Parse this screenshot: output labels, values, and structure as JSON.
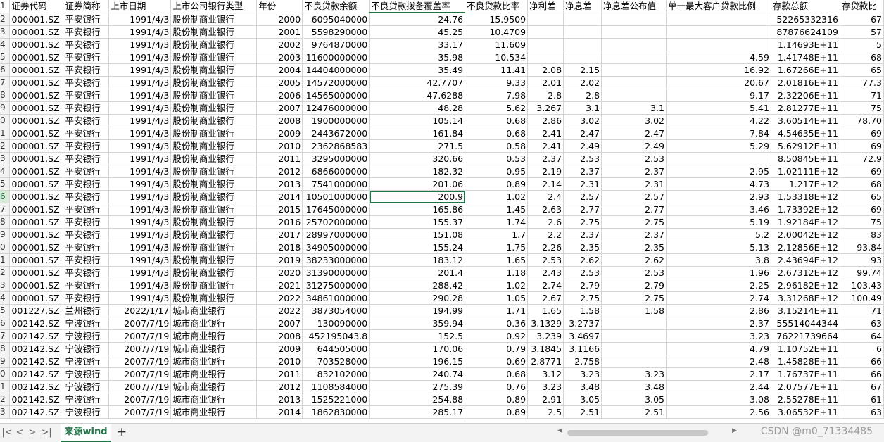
{
  "columns": [
    "证券代码",
    "证券简称",
    "上市日期",
    "上市公司银行类型",
    "年份",
    "不良贷款余额",
    "不良贷款拨备覆盖率",
    "不良贷款比率",
    "净利差",
    "净息差",
    "净息差公布值",
    "单一最大客户贷款比例",
    "存款总额",
    "存贷款比"
  ],
  "row_numbers": [
    "1",
    "2",
    "3",
    "4",
    "5",
    "6",
    "7",
    "8",
    "9",
    "0",
    "1",
    "2",
    "3",
    "4",
    "5",
    "6",
    "7",
    "8",
    "9",
    "0",
    "1",
    "2",
    "3",
    "4",
    "5",
    "6",
    "7",
    "8",
    "9",
    "0",
    "1",
    "2",
    "3"
  ],
  "rows": [
    [
      "000001.SZ",
      "平安银行",
      "1991/4/3",
      "股份制商业银行",
      "2000",
      "6095040000",
      "24.76",
      "15.9509",
      "",
      "",
      "",
      "",
      "52265332316",
      "67"
    ],
    [
      "000001.SZ",
      "平安银行",
      "1991/4/3",
      "股份制商业银行",
      "2001",
      "5598290000",
      "45.25",
      "10.4709",
      "",
      "",
      "",
      "",
      "87876624109",
      "57"
    ],
    [
      "000001.SZ",
      "平安银行",
      "1991/4/3",
      "股份制商业银行",
      "2002",
      "9764870000",
      "33.17",
      "11.609",
      "",
      "",
      "",
      "",
      "1.14693E+11",
      "5"
    ],
    [
      "000001.SZ",
      "平安银行",
      "1991/4/3",
      "股份制商业银行",
      "2003",
      "11600000000",
      "35.98",
      "10.534",
      "",
      "",
      "",
      "4.59",
      "1.41748E+11",
      "68"
    ],
    [
      "000001.SZ",
      "平安银行",
      "1991/4/3",
      "股份制商业银行",
      "2004",
      "14404000000",
      "35.49",
      "11.41",
      "2.08",
      "2.15",
      "",
      "16.92",
      "1.67266E+11",
      "65"
    ],
    [
      "000001.SZ",
      "平安银行",
      "1991/4/3",
      "股份制商业银行",
      "2005",
      "14572000000",
      "42.7707",
      "9.33",
      "2.01",
      "2.02",
      "",
      "20.67",
      "2.01816E+11",
      "77.3"
    ],
    [
      "000001.SZ",
      "平安银行",
      "1991/4/3",
      "股份制商业银行",
      "2006",
      "14565000000",
      "47.6288",
      "7.98",
      "2.8",
      "2.8",
      "",
      "9.17",
      "2.32206E+11",
      "71"
    ],
    [
      "000001.SZ",
      "平安银行",
      "1991/4/3",
      "股份制商业银行",
      "2007",
      "12476000000",
      "48.28",
      "5.62",
      "3.267",
      "3.1",
      "3.1",
      "5.41",
      "2.81277E+11",
      "75"
    ],
    [
      "000001.SZ",
      "平安银行",
      "1991/4/3",
      "股份制商业银行",
      "2008",
      "1900000000",
      "105.14",
      "0.68",
      "2.86",
      "3.02",
      "3.02",
      "4.22",
      "3.60514E+11",
      "78.70"
    ],
    [
      "000001.SZ",
      "平安银行",
      "1991/4/3",
      "股份制商业银行",
      "2009",
      "2443672000",
      "161.84",
      "0.68",
      "2.41",
      "2.47",
      "2.47",
      "7.84",
      "4.54635E+11",
      "69"
    ],
    [
      "000001.SZ",
      "平安银行",
      "1991/4/3",
      "股份制商业银行",
      "2010",
      "2362868583",
      "271.5",
      "0.58",
      "2.41",
      "2.49",
      "2.49",
      "5.29",
      "5.62912E+11",
      "69"
    ],
    [
      "000001.SZ",
      "平安银行",
      "1991/4/3",
      "股份制商业银行",
      "2011",
      "3295000000",
      "320.66",
      "0.53",
      "2.37",
      "2.53",
      "2.53",
      "",
      "8.50845E+11",
      "72.9"
    ],
    [
      "000001.SZ",
      "平安银行",
      "1991/4/3",
      "股份制商业银行",
      "2012",
      "6866000000",
      "182.32",
      "0.95",
      "2.19",
      "2.37",
      "2.37",
      "2.95",
      "1.02111E+12",
      "69"
    ],
    [
      "000001.SZ",
      "平安银行",
      "1991/4/3",
      "股份制商业银行",
      "2013",
      "7541000000",
      "201.06",
      "0.89",
      "2.14",
      "2.31",
      "2.31",
      "4.73",
      "1.217E+12",
      "68"
    ],
    [
      "000001.SZ",
      "平安银行",
      "1991/4/3",
      "股份制商业银行",
      "2014",
      "10501000000",
      "200.9",
      "1.02",
      "2.4",
      "2.57",
      "2.57",
      "2.93",
      "1.53318E+12",
      "65"
    ],
    [
      "000001.SZ",
      "平安银行",
      "1991/4/3",
      "股份制商业银行",
      "2015",
      "17645000000",
      "165.86",
      "1.45",
      "2.63",
      "2.77",
      "2.77",
      "3.46",
      "1.73392E+12",
      "69"
    ],
    [
      "000001.SZ",
      "平安银行",
      "1991/4/3",
      "股份制商业银行",
      "2016",
      "25702000000",
      "155.37",
      "1.74",
      "2.6",
      "2.75",
      "2.75",
      "5.19",
      "1.92184E+12",
      "75"
    ],
    [
      "000001.SZ",
      "平安银行",
      "1991/4/3",
      "股份制商业银行",
      "2017",
      "28997000000",
      "151.08",
      "1.7",
      "2.2",
      "2.37",
      "2.37",
      "5.2",
      "2.00042E+12",
      "83"
    ],
    [
      "000001.SZ",
      "平安银行",
      "1991/4/3",
      "股份制商业银行",
      "2018",
      "34905000000",
      "155.24",
      "1.75",
      "2.26",
      "2.35",
      "2.35",
      "5.13",
      "2.12856E+12",
      "93.84"
    ],
    [
      "000001.SZ",
      "平安银行",
      "1991/4/3",
      "股份制商业银行",
      "2019",
      "38233000000",
      "183.12",
      "1.65",
      "2.53",
      "2.62",
      "2.62",
      "3.8",
      "2.43694E+12",
      "93"
    ],
    [
      "000001.SZ",
      "平安银行",
      "1991/4/3",
      "股份制商业银行",
      "2020",
      "31390000000",
      "201.4",
      "1.18",
      "2.43",
      "2.53",
      "2.53",
      "1.96",
      "2.67312E+12",
      "99.74"
    ],
    [
      "000001.SZ",
      "平安银行",
      "1991/4/3",
      "股份制商业银行",
      "2021",
      "31275000000",
      "288.42",
      "1.02",
      "2.74",
      "2.79",
      "2.79",
      "2.25",
      "2.96182E+12",
      "103.43"
    ],
    [
      "000001.SZ",
      "平安银行",
      "1991/4/3",
      "股份制商业银行",
      "2022",
      "34861000000",
      "290.28",
      "1.05",
      "2.67",
      "2.75",
      "2.75",
      "2.74",
      "3.31268E+12",
      "100.49"
    ],
    [
      "001227.SZ",
      "兰州银行",
      "2022/1/17",
      "城市商业银行",
      "2022",
      "3873054000",
      "194.99",
      "1.71",
      "1.65",
      "1.58",
      "1.58",
      "2.86",
      "3.15214E+11",
      "71"
    ],
    [
      "002142.SZ",
      "宁波银行",
      "2007/7/19",
      "城市商业银行",
      "2007",
      "130090000",
      "359.94",
      "0.36",
      "3.1329",
      "3.2737",
      "",
      "2.37",
      "55514044344",
      "63"
    ],
    [
      "002142.SZ",
      "宁波银行",
      "2007/7/19",
      "城市商业银行",
      "2008",
      "452195043.8",
      "152.5",
      "0.92",
      "3.239",
      "3.4697",
      "",
      "3.23",
      "76221739664",
      "64"
    ],
    [
      "002142.SZ",
      "宁波银行",
      "2007/7/19",
      "城市商业银行",
      "2009",
      "644505000",
      "170.06",
      "0.79",
      "3.1845",
      "3.1166",
      "",
      "4.79",
      "1.10752E+11",
      "6"
    ],
    [
      "002142.SZ",
      "宁波银行",
      "2007/7/19",
      "城市商业银行",
      "2010",
      "703528000",
      "196.15",
      "0.69",
      "2.8771",
      "2.758",
      "",
      "2.48",
      "1.45828E+11",
      "66"
    ],
    [
      "002142.SZ",
      "宁波银行",
      "2007/7/19",
      "城市商业银行",
      "2011",
      "832102000",
      "240.74",
      "0.68",
      "3.12",
      "3.23",
      "3.23",
      "2.17",
      "1.76737E+11",
      "66"
    ],
    [
      "002142.SZ",
      "宁波银行",
      "2007/7/19",
      "城市商业银行",
      "2012",
      "1108584000",
      "275.39",
      "0.76",
      "3.23",
      "3.48",
      "3.48",
      "2.44",
      "2.07577E+11",
      "67"
    ],
    [
      "002142.SZ",
      "宁波银行",
      "2007/7/19",
      "城市商业银行",
      "2013",
      "1525221000",
      "254.88",
      "0.89",
      "2.91",
      "3.05",
      "3.05",
      "3.08",
      "2.55278E+11",
      "61"
    ],
    [
      "002142.SZ",
      "宁波银行",
      "2007/7/19",
      "城市商业银行",
      "2014",
      "1862830000",
      "285.17",
      "0.89",
      "2.5",
      "2.51",
      "2.51",
      "2.56",
      "3.06532E+11",
      "63"
    ]
  ],
  "sheet_tab": "来源wind",
  "add_sheet": "+",
  "nav_icons": [
    "first-sheet",
    "prev-sheet",
    "next-sheet",
    "last-sheet"
  ],
  "watermark": "CSDN @m0_71334485",
  "accent_color": "#217346"
}
